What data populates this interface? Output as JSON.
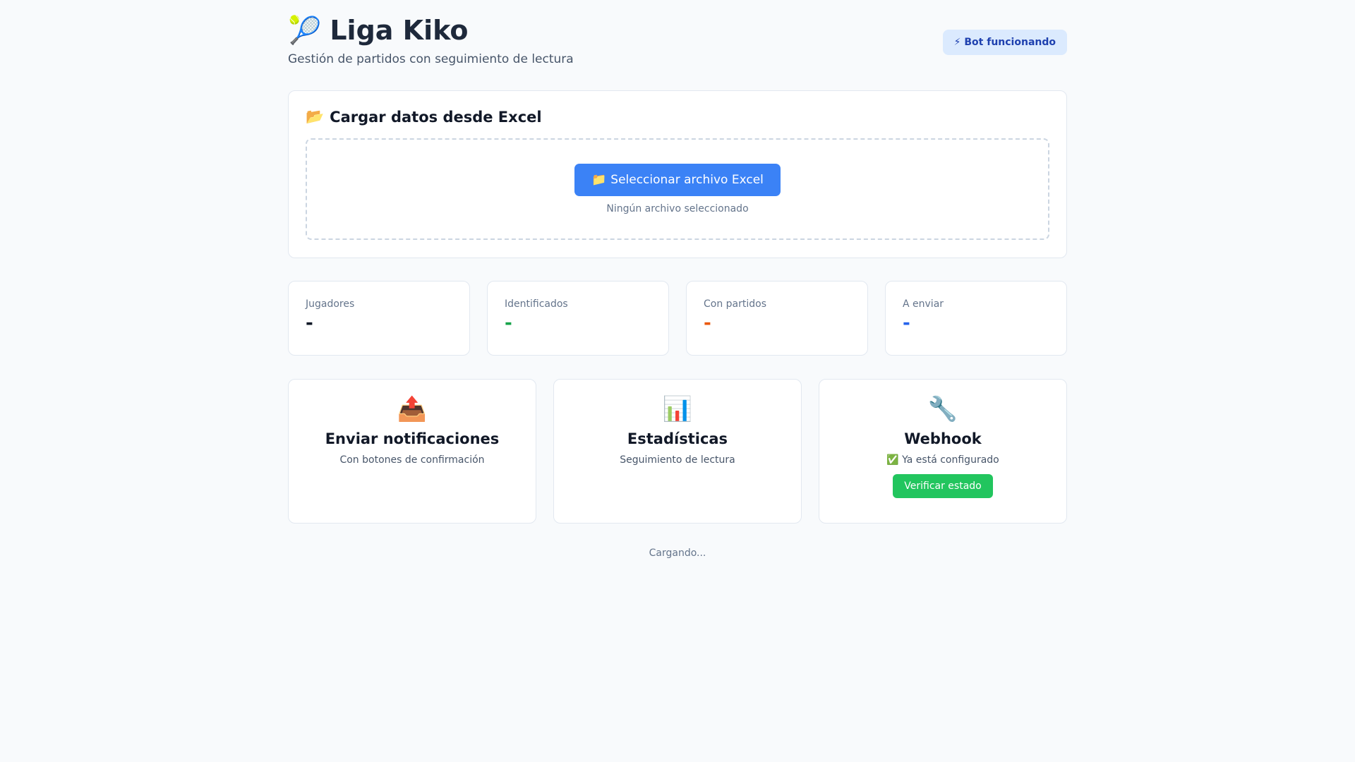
{
  "header": {
    "title_icon": "🎾",
    "title": "Liga Kiko",
    "subtitle": "Gestión de partidos con seguimiento de lectura",
    "status_icon": "⚡",
    "status_label": "Bot funcionando"
  },
  "upload": {
    "icon": "📂",
    "title": "Cargar datos desde Excel",
    "button_icon": "📁",
    "button_label": "Seleccionar archivo Excel",
    "file_status": "Ningún archivo seleccionado"
  },
  "stats": [
    {
      "label": "Jugadores",
      "value": "-",
      "color": "#111827"
    },
    {
      "label": "Identificados",
      "value": "-",
      "color": "#16a34a"
    },
    {
      "label": "Con partidos",
      "value": "-",
      "color": "#ea580c"
    },
    {
      "label": "A enviar",
      "value": "-",
      "color": "#2563eb"
    }
  ],
  "actions": [
    {
      "icon": "📤",
      "title": "Enviar notificaciones",
      "desc": "Con botones de confirmación"
    },
    {
      "icon": "📊",
      "title": "Estadísticas",
      "desc": "Seguimiento de lectura"
    },
    {
      "icon": "🔧",
      "title": "Webhook",
      "desc": "✅ Ya está configurado",
      "button_label": "Verificar estado"
    }
  ],
  "footer": {
    "status": "Cargando..."
  },
  "colors": {
    "primary": "#3b82f6",
    "success": "#22c55e",
    "pill_bg": "#dbeafe",
    "pill_text": "#1e40af"
  }
}
